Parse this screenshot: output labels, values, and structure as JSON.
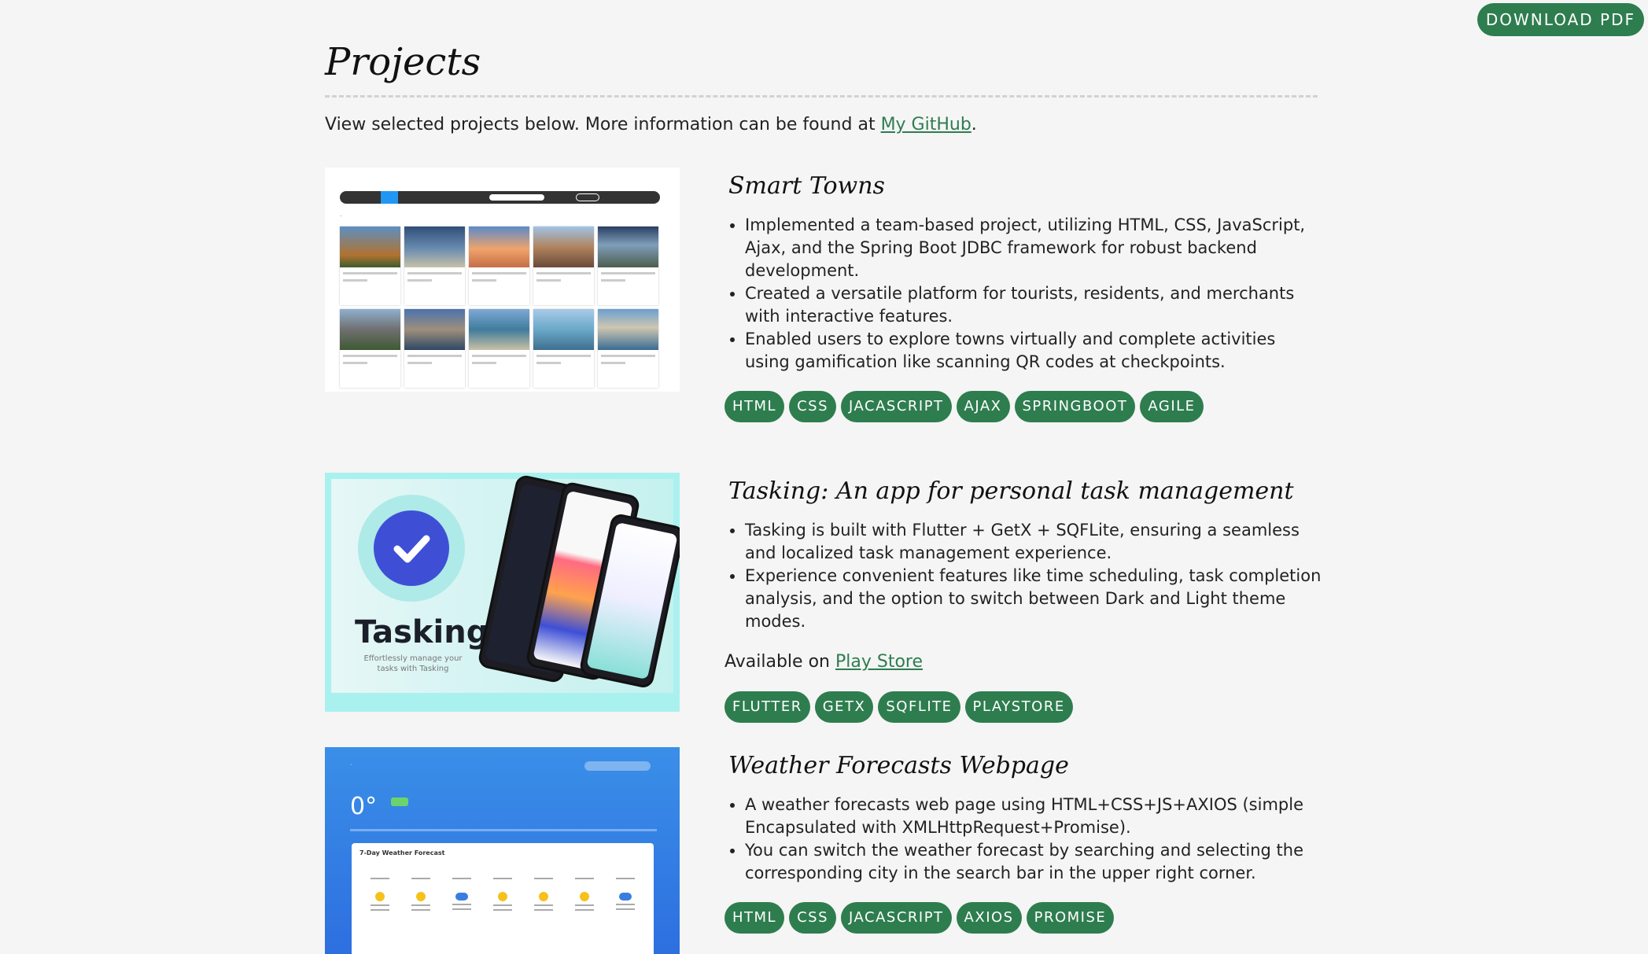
{
  "download_label": "DOWNLOAD PDF",
  "page_title": "Projects",
  "intro": {
    "text": "View selected projects below. More information can be found at ",
    "link": "My GitHub",
    "end": "."
  },
  "projects": [
    {
      "title": "Smart Towns",
      "bullets": [
        "Implemented a team-based project, utilizing HTML, CSS, JavaScript, Ajax, and the Spring Boot JDBC framework for robust backend development.",
        "Created a versatile platform for tourists, residents, and merchants with interactive features.",
        "Enabled users to explore towns virtually and complete activities using gamification like scanning QR codes at checkpoints."
      ],
      "tags": [
        "HTML",
        "CSS",
        "JACASCRIPT",
        "AJAX",
        "SPRINGBOOT",
        "AGILE"
      ]
    },
    {
      "title": "Tasking: An app for personal task management",
      "bullets": [
        "Tasking is built with Flutter + GetX + SQFLite, ensuring a seamless and localized task management experience.",
        "Experience convenient features like time scheduling, task completion analysis, and the option to switch between Dark and Light theme modes."
      ],
      "available_text": "Available on ",
      "available_link": "Play Store",
      "thumb_brand": "Tasking",
      "thumb_tagline": "Effortlessly manage your tasks with Tasking",
      "tags": [
        "FLUTTER",
        "GETX",
        "SQFLITE",
        "PLAYSTORE"
      ]
    },
    {
      "title": "Weather Forecasts Webpage",
      "bullets": [
        "A weather forecasts web page using HTML+CSS+JS+AXIOS (simple Encapsulated with XMLHttpRequest+Promise).",
        "You can switch the weather forecast by searching and selecting the corresponding city in the search bar in the upper right corner."
      ],
      "thumb_temp": "0°",
      "thumb_panel_title": "7-Day Weather Forecast",
      "tags": [
        "HTML",
        "CSS",
        "JACASCRIPT",
        "AXIOS",
        "PROMISE"
      ]
    }
  ],
  "colors": {
    "accent": "#2e7d4f",
    "background": "#f5f5f5"
  }
}
